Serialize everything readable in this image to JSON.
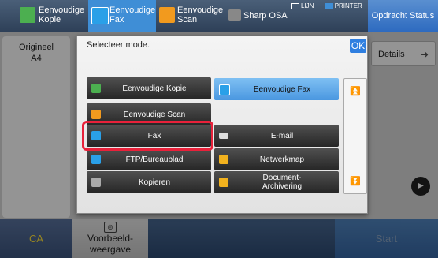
{
  "topbar": {
    "tabs": [
      {
        "label": "Eenvoudige\nKopie",
        "icon": "copy-icon"
      },
      {
        "label": "Eenvoudige\nFax",
        "icon": "fax-icon",
        "active": true
      },
      {
        "label": "Eenvoudige\nScan",
        "icon": "scan-icon"
      },
      {
        "label": "Sharp OSA",
        "icon": "osa-icon"
      }
    ],
    "indicators": {
      "line": "LIJN",
      "printer": "PRINTER"
    },
    "opdracht_status": "Opdracht Status"
  },
  "background": {
    "origineel": "Origineel",
    "paper_size": "A4",
    "details": "Details"
  },
  "dialog": {
    "title": "Selecteer mode.",
    "ok": "OK",
    "modes": [
      "Eenvoudige Kopie",
      "Eenvoudige Fax",
      "Eenvoudige Scan",
      "Fax",
      "E-mail",
      "FTP/Bureaublad",
      "Netwerkmap",
      "Kopieren",
      "Document-\nArchivering"
    ]
  },
  "bottombar": {
    "ca": "CA",
    "preview": "Voorbeeld-\nweergave",
    "start": "Start"
  },
  "colors": {
    "accent": "#3f8ed6",
    "highlight": "#e8213a",
    "ok": "#2f7fe0"
  }
}
